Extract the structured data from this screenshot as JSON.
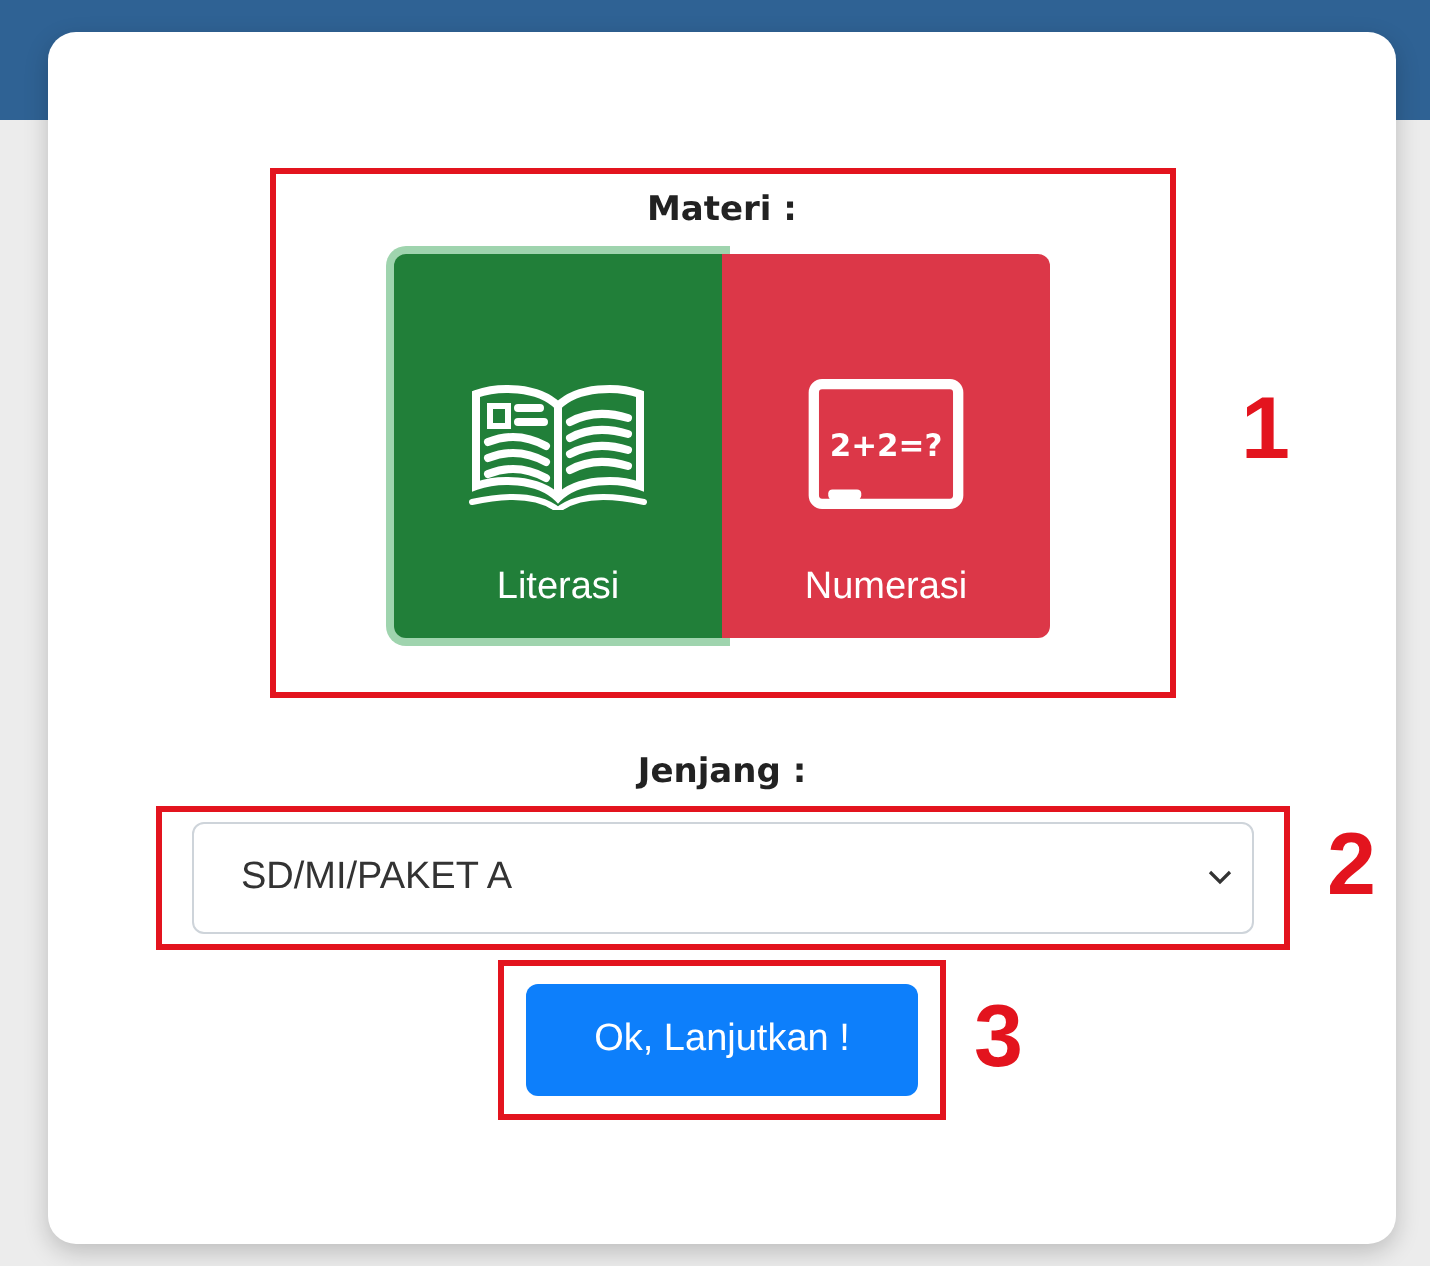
{
  "materi": {
    "label": "Materi :",
    "annotation": "1",
    "options": [
      {
        "label": "Literasi",
        "kind": "book",
        "color": "#217f39",
        "selected": true
      },
      {
        "label": "Numerasi",
        "kind": "board",
        "board_text": "2+2=?",
        "color": "#dc3748",
        "selected": false
      }
    ]
  },
  "jenjang": {
    "label": "Jenjang :",
    "value": "SD/MI/PAKET A",
    "annotation": "2"
  },
  "submit": {
    "label": "Ok, Lanjutkan !",
    "annotation": "3"
  }
}
